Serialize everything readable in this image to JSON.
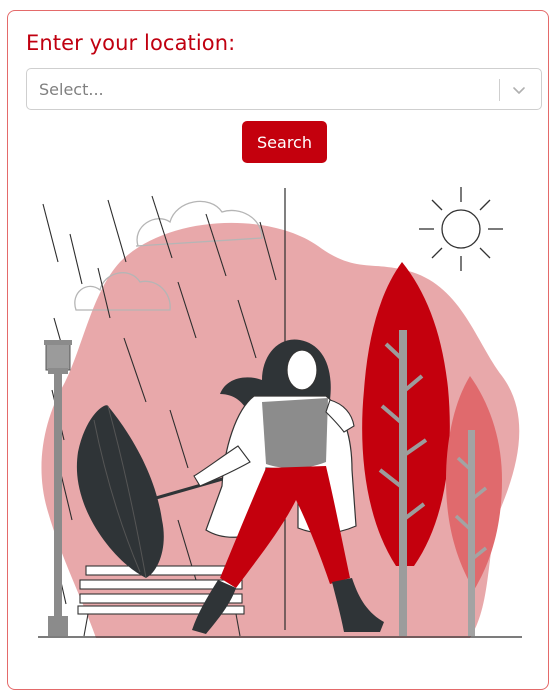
{
  "form": {
    "heading": "Enter your location:",
    "location_select": {
      "placeholder": "Select...",
      "dropdown_icon": "chevron-down-icon"
    },
    "search_button": "Search"
  },
  "illustration": {
    "subject": "woman-with-umbrella-in-weather-illustration",
    "icons": [
      "sun-icon",
      "cloud-icon",
      "rain-icon",
      "tree-icon",
      "street-lamp-icon",
      "bench-icon",
      "umbrella-icon"
    ]
  },
  "colors": {
    "accent": "#c4000d",
    "heading": "#c00010",
    "blob": "#e8a8aa",
    "light_red": "#e06a6d",
    "border": "#e46a6a"
  }
}
